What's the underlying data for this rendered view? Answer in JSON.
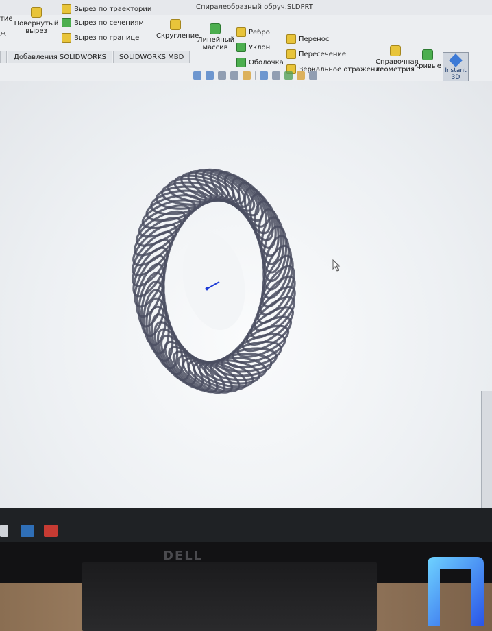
{
  "window": {
    "title": "Спиралеобразный обруч.SLDPRT"
  },
  "ribbon": {
    "left_partial_1": "тие",
    "left_partial_2": "ж",
    "revolved_cut": "Повернутый вырез",
    "sweep_cut": "Вырез по траектории",
    "loft_cut": "Вырез по сечениям",
    "boundary_cut": "Вырез по границе",
    "fillet": "Скругление",
    "linear_pattern": "Линейный массив",
    "rib": "Ребро",
    "draft": "Уклон",
    "shell": "Оболочка",
    "move": "Перенос",
    "intersect": "Пересечение",
    "mirror": "Зеркальное отражение",
    "ref_geometry": "Справочная геометрия",
    "curves": "Кривые",
    "instant3d": "Instant 3D"
  },
  "tabs": [
    {
      "label": "Добавления SOLIDWORKS"
    },
    {
      "label": "SOLIDWORKS MBD"
    }
  ],
  "monitor": {
    "brand": "DELL"
  },
  "colors": {
    "model": "#4a4e60",
    "accent": "#3d7ad6",
    "bg": "#f2f3f5"
  }
}
